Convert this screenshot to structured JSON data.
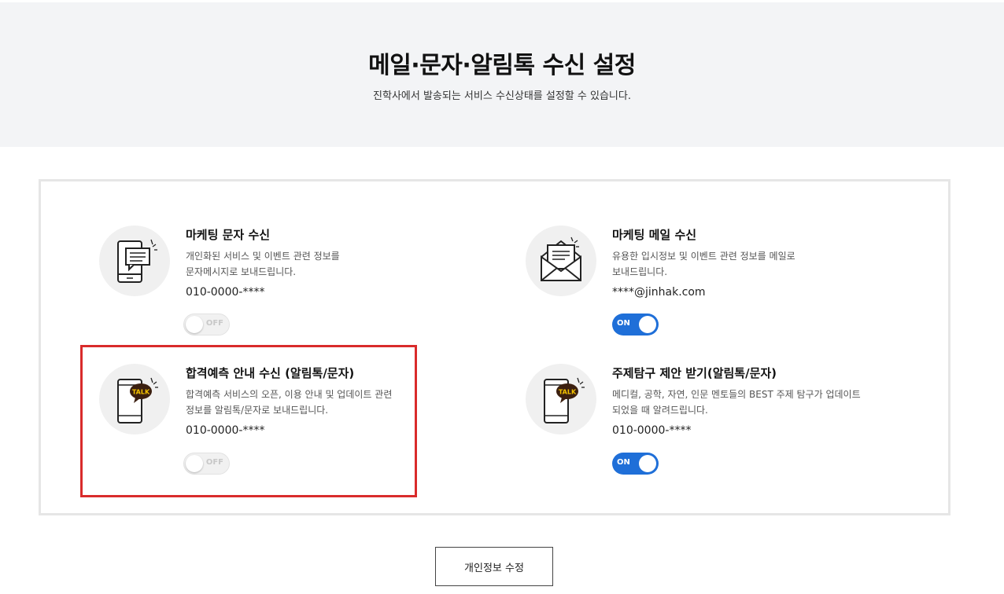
{
  "header": {
    "title": "메일·문자·알림톡 수신 설정",
    "subtitle": "진학사에서 발송되는 서비스 수신상태를 설정할 수 있습니다."
  },
  "items": [
    {
      "title": "마케팅 문자 수신",
      "desc": "개인화된 서비스 및 이벤트 관련 정보를\n문자메시지로 보내드립니다.",
      "contact": "010-0000-****",
      "toggle_label": "OFF",
      "icon": "phone-message-icon"
    },
    {
      "title": "마케팅 메일 수신",
      "desc": "유용한 입시정보 및 이벤트 관련 정보를 메일로\n보내드립니다.",
      "contact": "****@jinhak.com",
      "toggle_label": "ON",
      "icon": "envelope-icon"
    },
    {
      "title": "합격예측 안내 수신 (알림톡/문자)",
      "desc": "합격예측 서비스의 오픈, 이용 안내 및 업데이트 관련\n정보를 알림톡/문자로 보내드립니다.",
      "contact": "010-0000-****",
      "toggle_label": "OFF",
      "icon": "phone-talk-icon"
    },
    {
      "title": "주제탐구 제안 받기(알림톡/문자)",
      "desc": "메디컬, 공학, 자연, 인문 멘토들의 BEST 주제 탐구가 업데이트\n되었을 때 알려드립니다.",
      "contact": "010-0000-****",
      "toggle_label": "ON",
      "icon": "phone-talk-icon"
    }
  ],
  "talk_badge": "TALK",
  "footer": {
    "edit_label": "개인정보 수정"
  },
  "colors": {
    "on": "#1f6fd8",
    "highlight": "#d92b2b",
    "talk_badge": "#3b1f0f",
    "talk_text": "#f5c400"
  }
}
